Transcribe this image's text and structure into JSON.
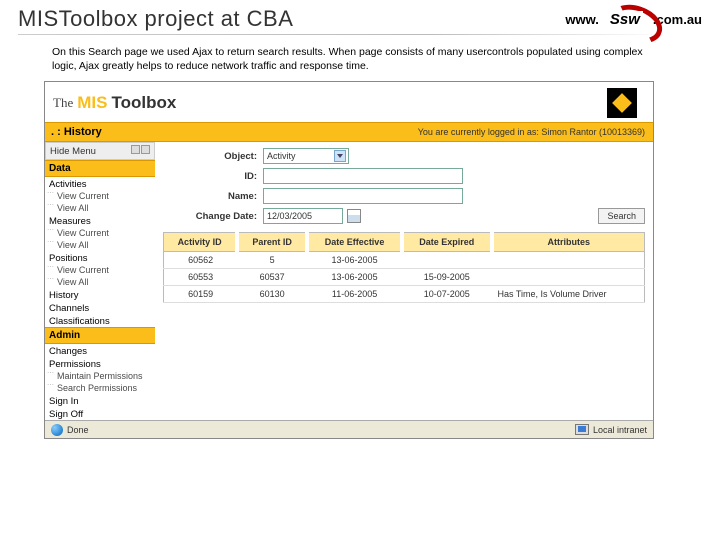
{
  "slide": {
    "title": "MISToolbox project at CBA",
    "description": "On this Search page we used Ajax to return search results. When page consists of many usercontrols populated using complex logic, Ajax greatly helps to reduce network traffic and response time.",
    "ssw_prefix": "www.",
    "ssw_brand": "Ssw",
    "ssw_suffix": ".com.au"
  },
  "app": {
    "banner_the": "The",
    "banner_mis": "MIS",
    "banner_toolbox": "Toolbox",
    "crumb": ". : History",
    "login_info": "You are currently logged in as: Simon Rantor (10013369)"
  },
  "rail": {
    "hide_menu": "Hide Menu",
    "section_data": "Data",
    "group_activities": "Activities",
    "act_view_current": "View Current",
    "act_view_all": "View All",
    "group_measures": "Measures",
    "mea_view_current": "View Current",
    "mea_view_all": "View All",
    "group_positions": "Positions",
    "pos_view_current": "View Current",
    "pos_view_all": "View All",
    "group_history": "History",
    "group_channels": "Channels",
    "group_class": "Classifications",
    "section_admin": "Admin",
    "group_changes": "Changes",
    "group_perm": "Permissions",
    "perm_maintain": "Maintain Permissions",
    "perm_search": "Search Permissions",
    "group_signin": "Sign In",
    "group_signoff": "Sign Off"
  },
  "form": {
    "object_label": "Object:",
    "object_value": "Activity",
    "id_label": "ID:",
    "id_value": "",
    "name_label": "Name:",
    "name_value": "",
    "changedate_label": "Change Date:",
    "changedate_value": "12/03/2005",
    "search_btn": "Search"
  },
  "grid": {
    "headers": {
      "activity_id": "Activity ID",
      "parent_id": "Parent ID",
      "date_eff": "Date Effective",
      "date_exp": "Date Expired",
      "attributes": "Attributes"
    },
    "rows": [
      {
        "activity_id": "60562",
        "parent_id": "5",
        "date_eff": "13-06-2005",
        "date_exp": "",
        "attributes": ""
      },
      {
        "activity_id": "60553",
        "parent_id": "60537",
        "date_eff": "13-06-2005",
        "date_exp": "15-09-2005",
        "attributes": ""
      },
      {
        "activity_id": "60159",
        "parent_id": "60130",
        "date_eff": "11-06-2005",
        "date_exp": "10-07-2005",
        "attributes": "Has Time, Is Volume Driver"
      }
    ]
  },
  "status": {
    "left": "Done",
    "right": "Local intranet"
  }
}
